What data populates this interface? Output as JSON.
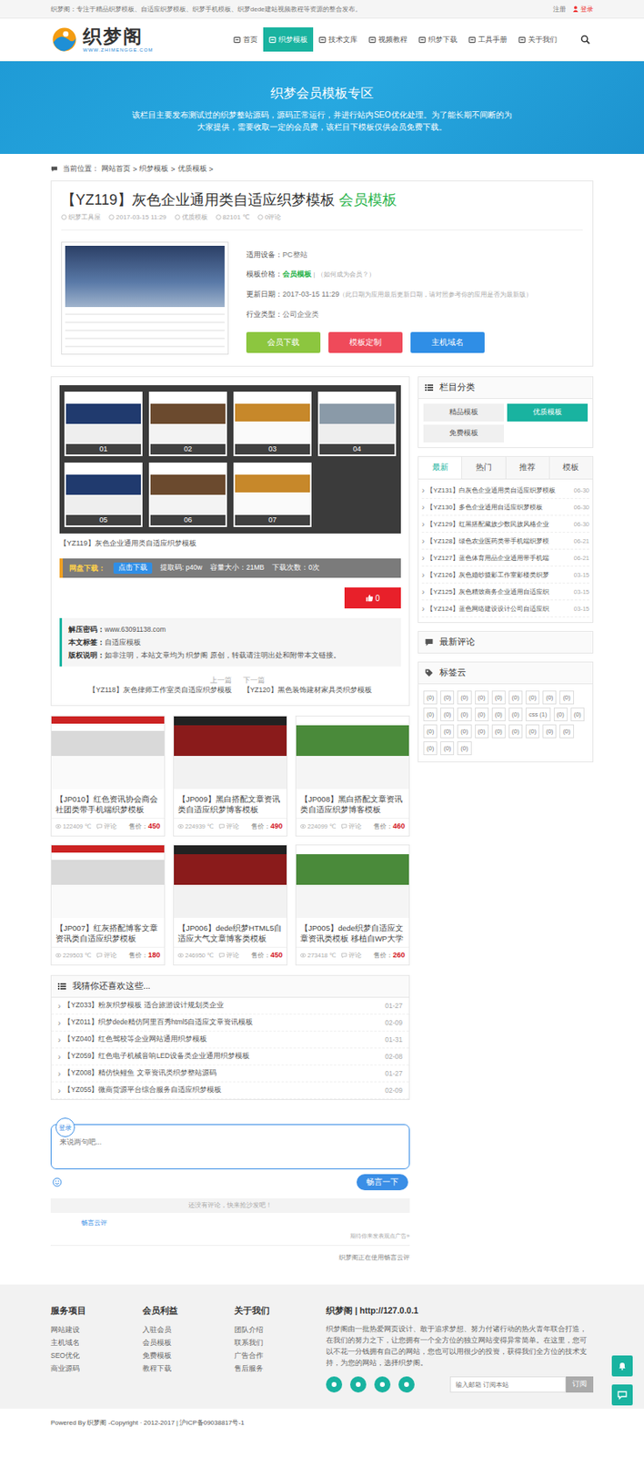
{
  "topbar": {
    "notice": "织梦阁：专注于精品织梦模板、自适应织梦模板、织梦手机模板、织梦dede建站视频教程等资源的整合发布。",
    "register": "注册",
    "login": "登录"
  },
  "logo": {
    "name": "织梦阁",
    "tagline": "WWW.ZHIMENGGE.COM"
  },
  "nav": [
    {
      "label": "首页",
      "selected": false
    },
    {
      "label": "织梦模板",
      "selected": true
    },
    {
      "label": "技术文库",
      "selected": false
    },
    {
      "label": "视频教程",
      "selected": false
    },
    {
      "label": "织梦下载",
      "selected": false
    },
    {
      "label": "工具手册",
      "selected": false
    },
    {
      "label": "关于我们",
      "selected": false
    }
  ],
  "banner": {
    "title": "织梦会员模板专区",
    "text": "该栏目主要发布测试过的织梦整站源码，源码正常运行，并进行站内SEO优化处理。为了能长期不间断的为大家提供，需要收取一定的会员费，该栏目下模板仅供会员免费下载。"
  },
  "breadcrumb": {
    "label": "当前位置：",
    "items": [
      "网站首页",
      "织梦模板",
      "优质模板"
    ],
    "separator": ">"
  },
  "product": {
    "title": "【YZ119】灰色企业通用类自适应织梦模板",
    "badge": "会员模板",
    "meta": [
      "织梦工具屋",
      "2017-03-15 11:29",
      "优质模板",
      "82101 ℃",
      "0评论"
    ],
    "specs": [
      {
        "label": "适用设备：",
        "value": "PC整站",
        "accent": false,
        "note": ""
      },
      {
        "label": "模板价格：",
        "value": "会员模板",
        "accent": true,
        "note": " | （如何成为会员？）"
      },
      {
        "label": "更新日期：",
        "value": "2017-03-15 11:29",
        "accent": false,
        "note": "（此日期为应用最后更新日期，请对照参考你的应用是否为最新版）"
      },
      {
        "label": "行业类型：",
        "value": "公司企业类",
        "accent": false,
        "note": ""
      }
    ],
    "buttons": [
      {
        "label": "会员下载",
        "color": "#8cc63f"
      },
      {
        "label": "模板定制",
        "color": "#ef4a5a"
      },
      {
        "label": "主机域名",
        "color": "#2f8ee6"
      }
    ]
  },
  "gallery": {
    "thumbs": [
      "01",
      "02",
      "03",
      "04",
      "05",
      "06",
      "07"
    ],
    "caption": "【YZ119】灰色企业通用类自适应织梦模板"
  },
  "download": {
    "label": "网盘下载：",
    "button": "点击下载",
    "code": "提取码: p40w",
    "size": "容量大小：21MB",
    "count": "下载次数：0次"
  },
  "likes": "0",
  "info": [
    {
      "label": "解压密码：",
      "value": "www.63091138.com"
    },
    {
      "label": "本文标签：",
      "value": "自适应模板"
    },
    {
      "label": "版权说明：",
      "value": "如非注明，本站文章均为 织梦阁 原创，转载请注明出处和附带本文链接。"
    }
  ],
  "pager": [
    {
      "label": "上一篇",
      "title": "【YZ118】灰色律师工作室类自适应织梦模板"
    },
    {
      "label": "下一篇",
      "title": "【YZ120】黑色装饰建材家具类织梦模板"
    }
  ],
  "related": [
    {
      "title": "【JP010】红色资讯协会商会社团类带手机端织梦模板",
      "views": "122409 ℃",
      "comments": "评论",
      "priceLabel": "售价：",
      "price": "450"
    },
    {
      "title": "【JP009】黑白搭配文章资讯类自适应织梦博客模板",
      "views": "224939 ℃",
      "comments": "评论",
      "priceLabel": "售价：",
      "price": "490"
    },
    {
      "title": "【JP008】黑白搭配文章资讯类自适应织梦博客模板",
      "views": "224099 ℃",
      "comments": "评论",
      "priceLabel": "售价：",
      "price": "460"
    },
    {
      "title": "【JP007】红灰搭配博客文章资讯类自适应织梦模板",
      "views": "229503 ℃",
      "comments": "评论",
      "priceLabel": "售价：",
      "price": "180"
    },
    {
      "title": "【JP006】dede织梦HTML5自适应大气文章博客类模板",
      "views": "246950 ℃",
      "comments": "评论",
      "priceLabel": "售价：",
      "price": "450"
    },
    {
      "title": "【JP005】dede织梦自适应文章资讯类模板 移植自WP大学",
      "views": "273418 ℃",
      "comments": "评论",
      "priceLabel": "售价：",
      "price": "260"
    }
  ],
  "guess": {
    "title": "我猜你还喜欢这些...",
    "items": [
      {
        "title": "【YZ033】粉灰织梦模板 适合旅游设计规划类企业",
        "date": "01-27"
      },
      {
        "title": "【YZ011】织梦dede精仿阿里百秀html5自适应文章资讯模板",
        "date": "02-09"
      },
      {
        "title": "【YZ040】红色驾校等企业网站通用织梦模板",
        "date": "01-31"
      },
      {
        "title": "【YZ059】红色电子机械音响LED设备类企业通用织梦模板",
        "date": "02-08"
      },
      {
        "title": "【YZ008】精仿快鲤鱼 文章资讯类织梦整站源码",
        "date": "01-27"
      },
      {
        "title": "【YZ055】微商货源平台综合服务自适应织梦模板",
        "date": "02-09"
      }
    ]
  },
  "comments": {
    "login": "登录",
    "placeholder": "来说两句吧...",
    "submit": "畅言一下",
    "empty": "还没有评论，快来抢沙发吧！",
    "brand": "畅言云评",
    "ad": "期待你来发表观点广告»",
    "powered": "织梦阁正在使用畅言云评"
  },
  "sidebar": {
    "categories": {
      "title": "栏目分类",
      "items": [
        {
          "label": "精品模板",
          "selected": false
        },
        {
          "label": "优质模板",
          "selected": true
        },
        {
          "label": "免费模板",
          "selected": false
        }
      ]
    },
    "tabs": [
      {
        "label": "最新",
        "selected": true
      },
      {
        "label": "热门",
        "selected": false
      },
      {
        "label": "推荐",
        "selected": false
      },
      {
        "label": "模板",
        "selected": false
      }
    ],
    "latest": [
      {
        "title": "【YZ131】白灰色企业通用类自适应织梦模板",
        "date": "06-30"
      },
      {
        "title": "【YZ130】多色企业通用自适应织梦模板",
        "date": "06-30"
      },
      {
        "title": "【YZ129】红黑搭配藏族少数民族风格企业",
        "date": "06-30"
      },
      {
        "title": "【YZ128】绿色农业医药类带手机端织梦模",
        "date": "06-21"
      },
      {
        "title": "【YZ127】蓝色体育用品企业通用带手机端",
        "date": "06-21"
      },
      {
        "title": "【YZ126】灰色婚纱摄影工作室影楼类织梦",
        "date": "03-15"
      },
      {
        "title": "【YZ125】灰色精致商务企业通用自适应织",
        "date": "03-15"
      },
      {
        "title": "【YZ124】蓝色网络建设设计公司自适应织",
        "date": "03-15"
      }
    ],
    "recent": {
      "title": "最新评论"
    },
    "tags": {
      "title": "标签云",
      "items": [
        "(0)",
        "(0)",
        "(0)",
        "(0)",
        "(0)",
        "(0)",
        "(0)",
        "(0)",
        "(0)",
        "(0)",
        "(0)",
        "(0)",
        "(0)",
        "(0)",
        "(0)",
        "css (1)",
        "(0)",
        "(0)",
        "(0)",
        "(0)",
        "(0)",
        "(0)",
        "(0)",
        "(0)",
        "(0)",
        "(0)",
        "(0)",
        "(0)",
        "(0)",
        "(0)"
      ]
    }
  },
  "footer": {
    "columns": [
      {
        "title": "服务项目",
        "links": [
          "网站建设",
          "主机域名",
          "SEO优化",
          "商业源码"
        ]
      },
      {
        "title": "会员利益",
        "links": [
          "入驻会员",
          "会员模板",
          "免费模板",
          "教程下载"
        ]
      },
      {
        "title": "关于我们",
        "links": [
          "团队介绍",
          "联系我们",
          "广告合作",
          "售后服务"
        ]
      }
    ],
    "about": {
      "title": "织梦阁 | http://127.0.0.1",
      "text": "织梦阁由一批热爱网页设计、敢于追求梦想、努力付诸行动的热火青年联合打造，在我们的努力之下，让您拥有一个全方位的独立网站变得异常简单。在这里，您可以不花一分钱拥有自己的网站，您也可以用很少的投资，获得我们全方位的技术支持，为您的网站，选择织梦阁。",
      "placeholder": "输入邮箱 订阅本站",
      "button": "订阅"
    }
  },
  "copyright": "Powered By 织梦阁 -Copyright · 2012-2017 | 沪ICP备09038817号-1"
}
